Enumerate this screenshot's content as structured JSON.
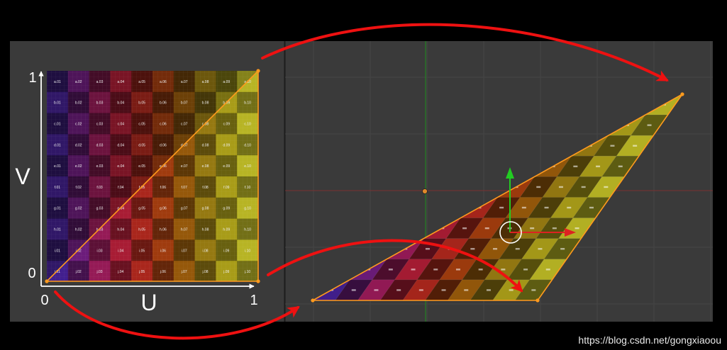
{
  "uv_editor": {
    "u_label": "U",
    "v_label": "V",
    "origin_label": "0",
    "u_max_label": "1",
    "v_max_label": "1",
    "cell_labels": [
      [
        "a.01",
        "a.02",
        "a.03",
        "a.04",
        "a.05",
        "a.06",
        "a.07",
        "a.08",
        "a.09",
        "a.10"
      ],
      [
        "b.01",
        "b.02",
        "b.03",
        "b.04",
        "b.05",
        "b.06",
        "b.07",
        "b.08",
        "b.09",
        "b.10"
      ],
      [
        "c.01",
        "c.02",
        "c.03",
        "c.04",
        "c.05",
        "c.06",
        "c.07",
        "c.08",
        "c.09",
        "c.10"
      ],
      [
        "d.01",
        "d.02",
        "d.03",
        "d.04",
        "d.05",
        "d.06",
        "d.07",
        "d.08",
        "d.09",
        "d.10"
      ],
      [
        "e.01",
        "e.02",
        "e.03",
        "e.04",
        "e.05",
        "e.06",
        "e.07",
        "e.08",
        "e.09",
        "e.10"
      ],
      [
        "f.01",
        "f.02",
        "f.03",
        "f.04",
        "f.05",
        "f.06",
        "f.07",
        "f.08",
        "f.09",
        "f.10"
      ],
      [
        "g.01",
        "g.02",
        "g.03",
        "g.04",
        "g.05",
        "g.06",
        "g.07",
        "g.08",
        "g.09",
        "g.10"
      ],
      [
        "h.01",
        "h.02",
        "h.03",
        "h.04",
        "h.05",
        "h.06",
        "h.07",
        "h.08",
        "h.09",
        "h.10"
      ],
      [
        "i.01",
        "i.02",
        "i.03",
        "i.04",
        "i.05",
        "i.06",
        "i.07",
        "i.08",
        "i.09",
        "i.10"
      ],
      [
        "j.01",
        "j.02",
        "j.03",
        "j.04",
        "j.05",
        "j.06",
        "j.07",
        "j.08",
        "j.09",
        "j.10"
      ]
    ]
  },
  "watermark": "https://blog.csdn.net/gongxiaoou",
  "colors": {
    "background": "#000000",
    "panel": "#3a3a3a",
    "edge": "#ff9a1e",
    "arrow": "#ee1111",
    "gizmo_up": "#22cc22",
    "gizmo_right": "#dd2222",
    "y_axis": "#1f8f1f",
    "x_axis": "#7a3030"
  },
  "gradient_stops": [
    "#2a1f8a",
    "#5a1a7a",
    "#8a1850",
    "#a01a28",
    "#9a2a10",
    "#8a4a08",
    "#8a7010",
    "#a09818",
    "#b0b028"
  ]
}
